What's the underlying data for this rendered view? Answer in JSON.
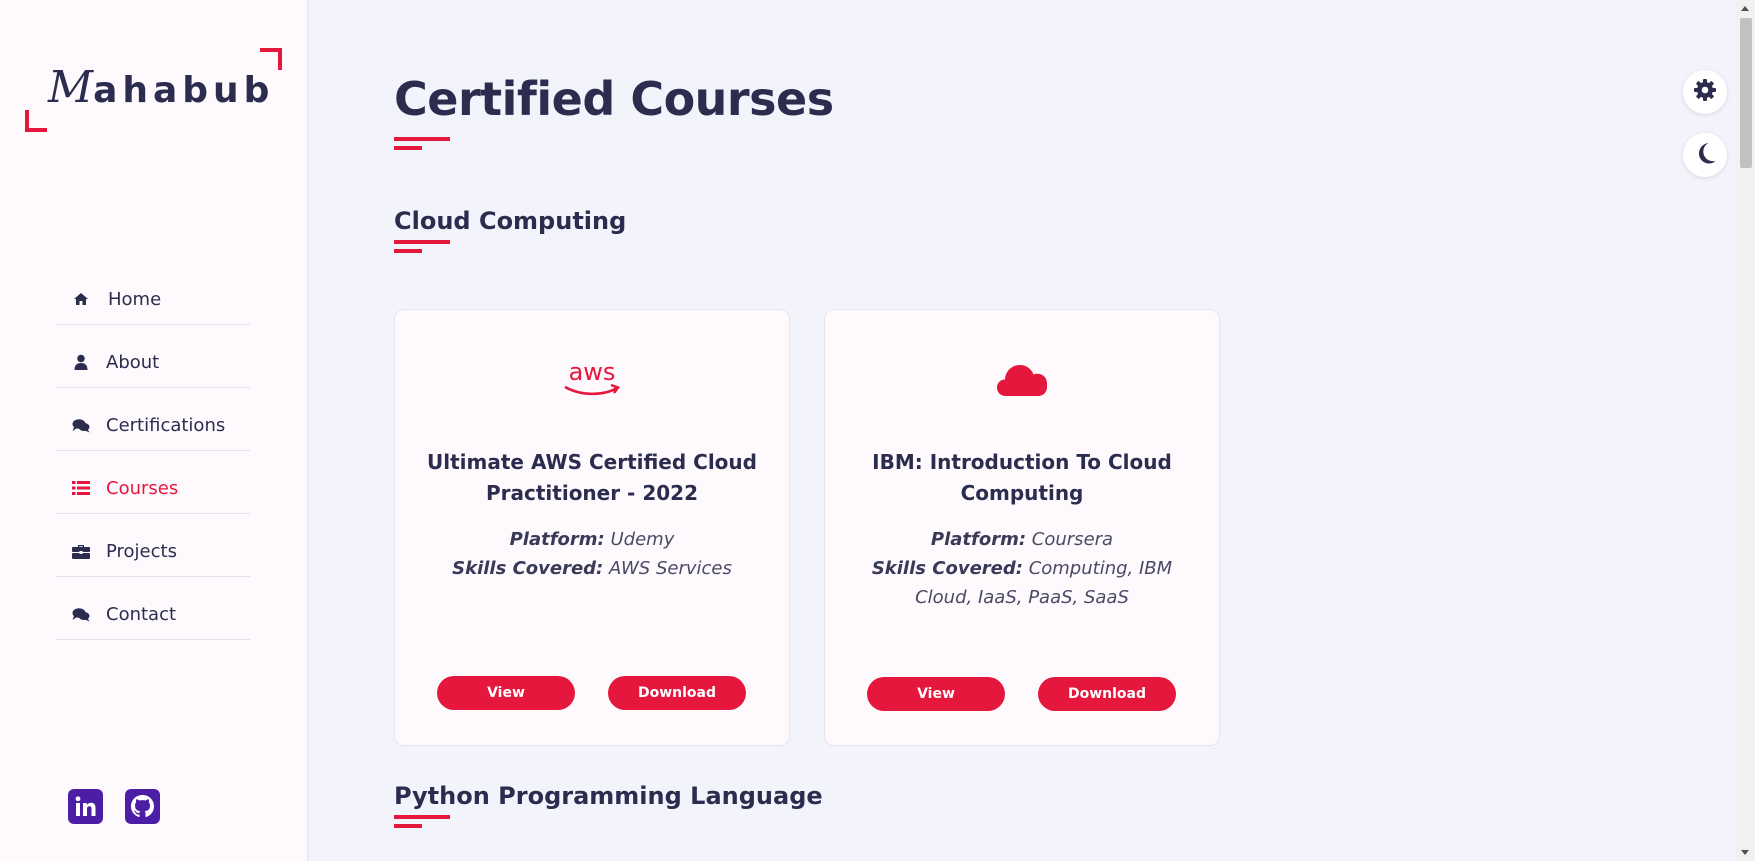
{
  "logo": {
    "script_letter": "M",
    "rest": "ahabub"
  },
  "nav": {
    "items": [
      {
        "label": "Home",
        "icon": "home-icon"
      },
      {
        "label": "About",
        "icon": "user-icon"
      },
      {
        "label": "Certifications",
        "icon": "comments-icon"
      },
      {
        "label": "Courses",
        "icon": "list-icon",
        "active": true
      },
      {
        "label": "Projects",
        "icon": "briefcase-icon"
      },
      {
        "label": "Contact",
        "icon": "comments-icon"
      }
    ]
  },
  "social": [
    "linkedin-icon",
    "github-icon"
  ],
  "page": {
    "title": "Certified Courses"
  },
  "sections": [
    {
      "title": "Cloud Computing",
      "cards": [
        {
          "icon": "aws-icon",
          "title": "Ultimate AWS Certified Cloud Practitioner - 2022",
          "platform_label": "Platform:",
          "platform": "Udemy",
          "skills_label": "Skills Covered:",
          "skills": "AWS Services",
          "view_label": "View",
          "download_label": "Download"
        },
        {
          "icon": "cloud-icon",
          "title": "IBM: Introduction To Cloud Computing",
          "platform_label": "Platform:",
          "platform": "Coursera",
          "skills_label": "Skills Covered:",
          "skills": "Computing, IBM Cloud, IaaS, PaaS, SaaS",
          "view_label": "View",
          "download_label": "Download"
        }
      ]
    },
    {
      "title": "Python Programming Language"
    }
  ],
  "floating": [
    "settings-icon",
    "dark-mode-icon"
  ],
  "colors": {
    "accent": "#e5173d",
    "text": "#2c2c4e",
    "social": "#4b1ea5"
  }
}
